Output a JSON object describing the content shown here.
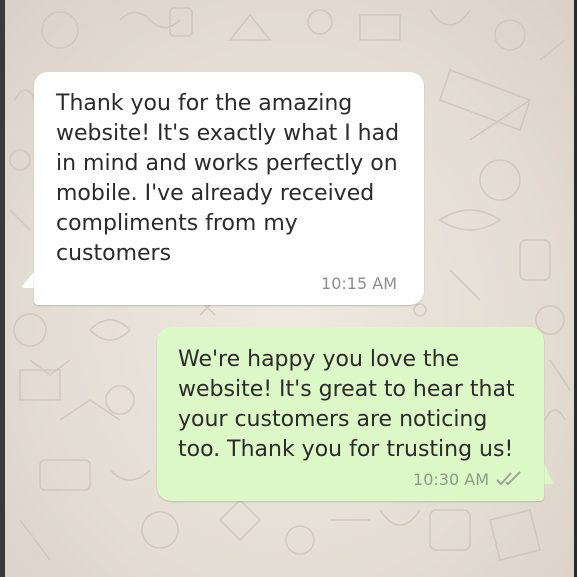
{
  "messages": [
    {
      "direction": "incoming",
      "text": "Thank you for the amazing\nwebsite! It's exactly what I had\nin mind and works perfectly on\nmobile. I've already received\ncompliments from my\ncustomers",
      "time": "10:15 AM"
    },
    {
      "direction": "outgoing",
      "text": "We're happy you love the\nwebsite! It's great to hear that\nyour customers are noticing\ntoo. Thank you for trusting us!",
      "time": "10:30 AM",
      "status_icon": "double-check-icon"
    }
  ],
  "colors": {
    "incoming_bubble": "#ffffff",
    "outgoing_bubble": "#dcf8c6",
    "background": "#e6dfd6",
    "timestamp": "#8c8c8c"
  }
}
